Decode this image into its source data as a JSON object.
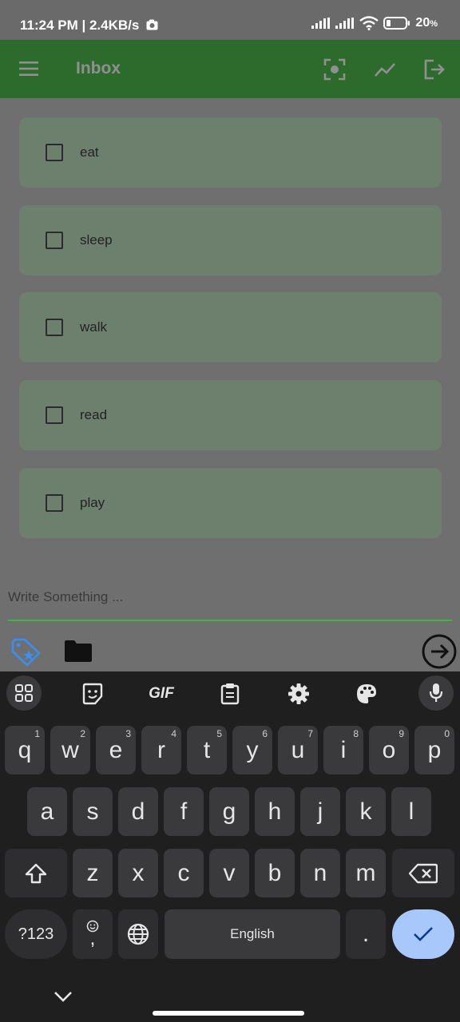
{
  "status_bar": {
    "time_net": "11:24 PM | 2.4KB/s",
    "battery": "20"
  },
  "app_bar": {
    "title": "Inbox",
    "icons": [
      "menu-icon",
      "scan-icon",
      "trending-icon",
      "logout-icon"
    ]
  },
  "todos": [
    {
      "label": "eat",
      "checked": false
    },
    {
      "label": "sleep",
      "checked": false
    },
    {
      "label": "walk",
      "checked": false
    },
    {
      "label": "read",
      "checked": false
    },
    {
      "label": "play",
      "checked": false
    }
  ],
  "composer": {
    "placeholder": "Write Something ...",
    "accent": "#4caf50"
  },
  "keyboard": {
    "row1": [
      "q",
      "w",
      "e",
      "r",
      "t",
      "y",
      "u",
      "i",
      "o",
      "p"
    ],
    "row1_hints": [
      "1",
      "2",
      "3",
      "4",
      "5",
      "6",
      "7",
      "8",
      "9",
      "0"
    ],
    "row2": [
      "a",
      "s",
      "d",
      "f",
      "g",
      "h",
      "j",
      "k",
      "l"
    ],
    "row3": [
      "z",
      "x",
      "c",
      "v",
      "b",
      "n",
      "m"
    ],
    "symbols_key": "?123",
    "comma_key": ",",
    "space_label": "English",
    "period_key": ".",
    "toolbar_gif": "GIF"
  },
  "colors": {
    "app_bar": "#2c6b2c",
    "todo_card": "#6d806d",
    "enter_key": "#a8c7fa"
  }
}
